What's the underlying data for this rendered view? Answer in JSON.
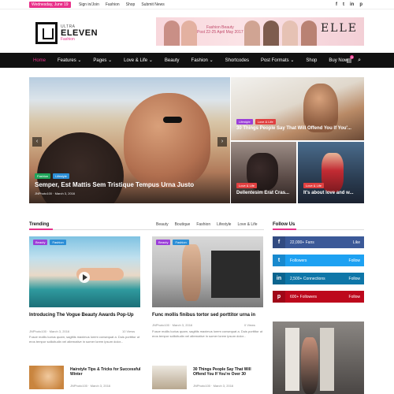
{
  "colors": {
    "accent": "#e8318a",
    "nav_bg": "#111111",
    "tag_green": "#1fa35a",
    "tag_pink": "#e8318a",
    "tag_blue": "#2b8ed6",
    "tag_purple": "#9b3fd8",
    "tag_red": "#e04040",
    "facebook": "#3b5998",
    "twitter": "#1da1f2",
    "linkedin": "#0e76a8",
    "pinterest": "#bd081c"
  },
  "topbar": {
    "date": "Wednesday, June 19",
    "links": [
      "Sign in/Join",
      "Fashion",
      "Shop",
      "Submit News"
    ],
    "social_icons": [
      "f",
      "t",
      "in",
      "p"
    ]
  },
  "logo": {
    "small": "ULTRA",
    "big": "ELEVEN",
    "sub": "Fashion"
  },
  "banner": {
    "line1": "Fashion Beauty",
    "line2": "Post 22-25 April May 2017",
    "brand": "ELLE"
  },
  "nav": {
    "items": [
      "Home",
      "Features",
      "Pages",
      "Love & Life",
      "Beauty",
      "Fashion",
      "Shortcodes",
      "Post Formats",
      "Shop",
      "Buy Now"
    ],
    "cart_count": "0"
  },
  "hero": {
    "main": {
      "tags": [
        "Fashion",
        "Lifestyle"
      ],
      "title": "Semper, Est Mattis Sem Tristique Tempus Urna Justo",
      "meta": "JNPhoto100  ·  March 3, 2016",
      "prev": "‹",
      "next": "›"
    },
    "top_right": {
      "tags": [
        "Lifestyle",
        "Love & Life"
      ],
      "title": "30 Things People Say That Will Offend You If You'..."
    },
    "bottom_left": {
      "tags": [
        "Love & Life"
      ],
      "title": "Dellentesim Erat Cras..."
    },
    "bottom_right": {
      "tags": [
        "Love & Life"
      ],
      "title": "It's about love and w..."
    }
  },
  "trending": {
    "heading": "Trending",
    "tabs": [
      "Beauty",
      "Boutique",
      "Fashion",
      "Lifestyle",
      "Love & Life"
    ],
    "posts": [
      {
        "tags": [
          "Beauty",
          "Fashion"
        ],
        "title": "Introducing The Vogue Beauty Awards Pop-Up",
        "meta": "JNPhoto100  ·  March 3, 2016",
        "views": "10 Views",
        "excerpt": "Fusce mollis luctus quam, sagittis maximus lorem consequat a. Duis porttitor ut eros tempor sollicitudin vel alternative in somer lorem ipsum dolor..."
      },
      {
        "tags": [
          "Beauty",
          "Fashion"
        ],
        "title": "Func mollis finibus tortor sed porttitor urna in",
        "meta": "JNPhoto100  ·  March 3, 2016",
        "views": "0 Views",
        "excerpt": "Fusce mollis luctus quam, sagittis maximus lorem consequat a. Duis porttitor ut eros tempor sollicitudin vel alternative in somer lorem ipsum dolor..."
      }
    ],
    "small_posts": [
      {
        "title": "Hairstyle Tips & Tricks for Successful Winter",
        "meta": "JNPhoto100  ·  March 3, 2016"
      },
      {
        "title": "30 Things People Say That Will Offend You If You're Over 30",
        "meta": "JNPhoto100  ·  March 3, 2016"
      }
    ]
  },
  "follow": {
    "heading": "Follow Us",
    "rows": [
      {
        "icon": "f",
        "count": "22,000+",
        "label": "Fans",
        "action": "Like"
      },
      {
        "icon": "t",
        "count": "",
        "label": "Followers",
        "action": "Follow"
      },
      {
        "icon": "in",
        "count": "2,500+",
        "label": "Connections",
        "action": "Follow"
      },
      {
        "icon": "p",
        "count": "600+",
        "label": "Followers",
        "action": "Follow"
      }
    ]
  }
}
